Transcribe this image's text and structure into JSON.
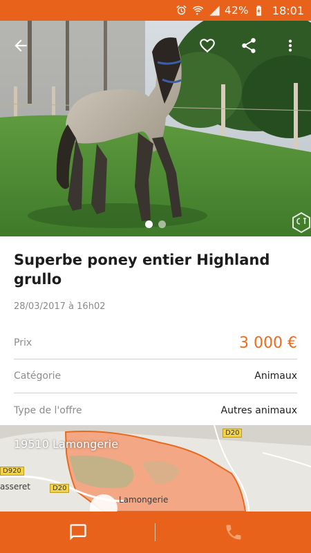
{
  "status_bar": {
    "battery_percent": "42%",
    "time": "18:01",
    "icons": [
      "alarm-icon",
      "wifi-icon",
      "signal-icon",
      "battery-icon"
    ]
  },
  "toolbar": {
    "icons": [
      "back-arrow-icon",
      "heart-icon",
      "share-icon",
      "more-vert-icon"
    ]
  },
  "gallery": {
    "total_images": 2,
    "current_index": 1
  },
  "listing": {
    "title": "Superbe poney entier Highland grullo",
    "date": "28/03/2017 à 16h02",
    "details": [
      {
        "label": "Prix",
        "value": "3 000 €"
      },
      {
        "label": "Catégorie",
        "value": "Animaux"
      },
      {
        "label": "Type de l'offre",
        "value": "Autres animaux"
      }
    ]
  },
  "map": {
    "location": "19510 Lamongerie",
    "places": [
      "Lamongerie",
      "asseret"
    ],
    "roads": [
      "D20",
      "D920",
      "D20"
    ]
  },
  "bottom_bar": {
    "icons": [
      "message-icon",
      "phone-icon"
    ]
  },
  "colors": {
    "accent": "#e9621b",
    "price": "#ee6b1e"
  }
}
